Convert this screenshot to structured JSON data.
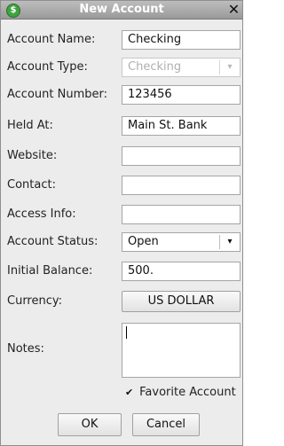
{
  "window": {
    "title": "New Account",
    "icon_glyph": "$",
    "close_glyph": "✕"
  },
  "fields": {
    "account_name": {
      "label": "Account Name:",
      "value": "Checking"
    },
    "account_type": {
      "label": "Account Type:",
      "value": "Checking"
    },
    "account_number": {
      "label": "Account Number:",
      "value": "123456"
    },
    "held_at": {
      "label": "Held At:",
      "value": "Main St. Bank"
    },
    "website": {
      "label": "Website:",
      "value": ""
    },
    "contact": {
      "label": "Contact:",
      "value": ""
    },
    "access_info": {
      "label": "Access Info:",
      "value": ""
    },
    "account_status": {
      "label": "Account Status:",
      "value": "Open"
    },
    "initial_balance": {
      "label": "Initial Balance:",
      "value": "500."
    },
    "currency": {
      "label": "Currency:",
      "value": "US DOLLAR"
    },
    "notes": {
      "label": "Notes:",
      "value": ""
    }
  },
  "favorite": {
    "label": "Favorite Account",
    "checked": true,
    "glyph": "✔"
  },
  "buttons": {
    "ok": "OK",
    "cancel": "Cancel"
  },
  "colors": {
    "title_text": "#ffffff",
    "titlebar": "#a8a8a8",
    "app_icon": "#3fa33f"
  }
}
